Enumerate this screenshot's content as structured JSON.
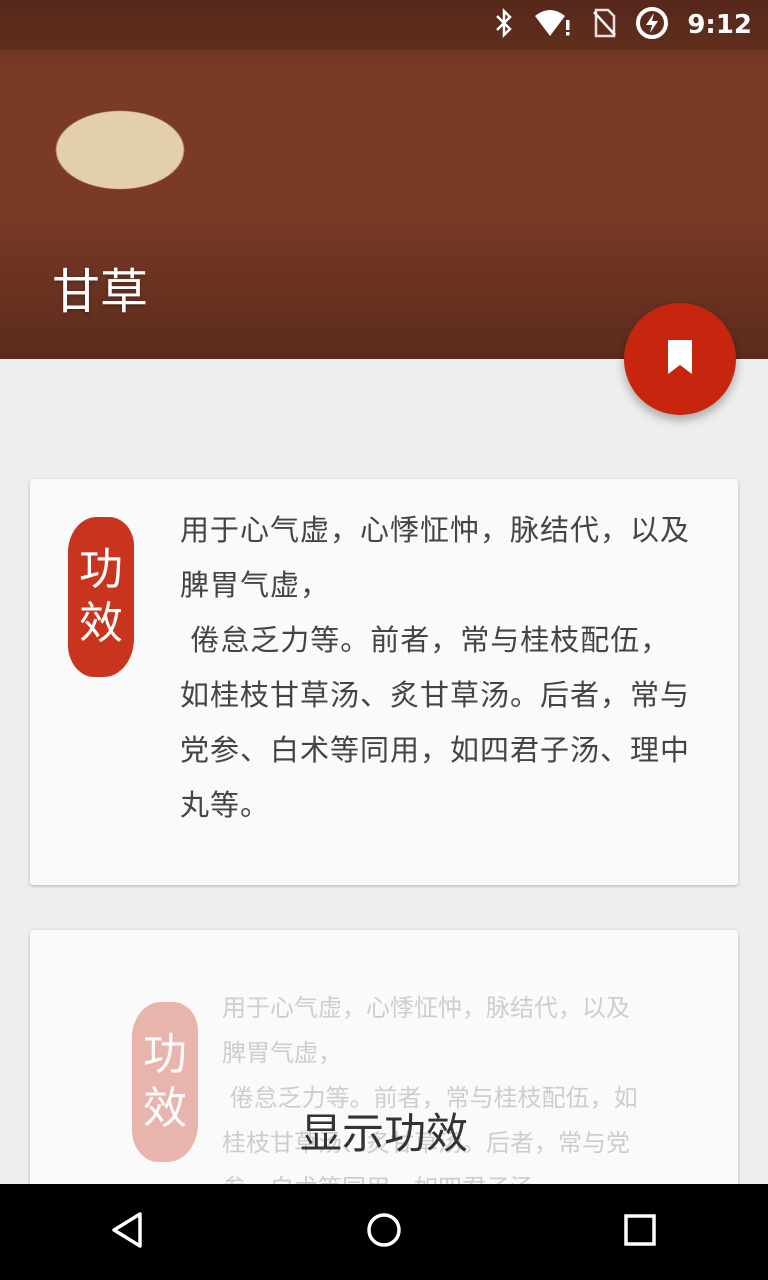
{
  "status_bar": {
    "time": "9:12",
    "icons": [
      "bluetooth-icon",
      "wifi-alert-icon",
      "no-sim-icon",
      "battery-charging-icon"
    ]
  },
  "header": {
    "title": "甘草"
  },
  "fab": {
    "icon": "bookmark-icon"
  },
  "card_primary": {
    "seal_chars": [
      "功",
      "效"
    ],
    "description": "用于心气虚，心悸怔忡，脉结代，以及脾胃气虚，\n 倦怠乏力等。前者，常与桂枝配伍，如桂枝甘草汤、炙甘草汤。后者，常与党参、白术等同用，如四君子汤、理中丸等。"
  },
  "card_secondary": {
    "seal_chars": [
      "功",
      "效"
    ],
    "description": "用于心气虚，心悸怔忡，脉结代，以及脾胃气虚，\n 倦怠乏力等。前者，常与桂枝配伍，如桂枝甘草汤、炙甘草汤。后者，常与党参、白术等同用，如四君子汤、",
    "action_label": "显示功效"
  },
  "nav_bar": {
    "buttons": [
      "back-icon",
      "home-icon",
      "recents-icon"
    ]
  },
  "colors": {
    "accent": "#c8250e",
    "seal": "#c9341f",
    "background": "#eeeeee",
    "card": "#fafafa"
  }
}
